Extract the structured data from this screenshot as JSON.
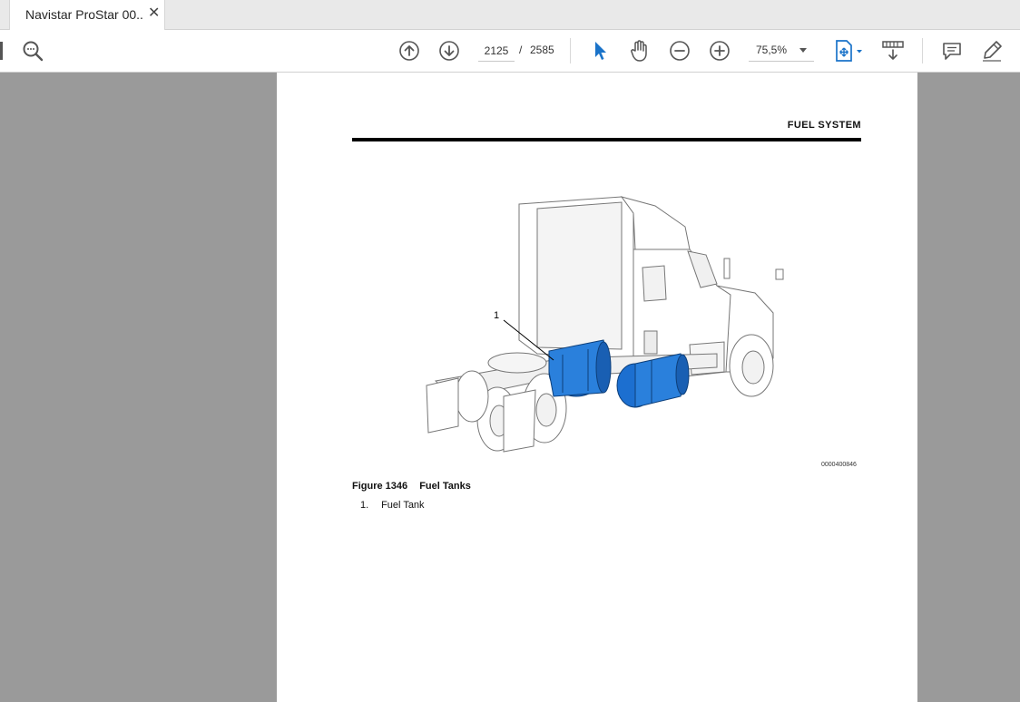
{
  "tab": {
    "title": "Navistar ProStar 00...",
    "close_glyph": "✕"
  },
  "toolbar": {
    "current_page": "2125",
    "page_separator": "/",
    "total_pages": "2585",
    "zoom": "75,5%",
    "icons": [
      "search-icon",
      "page-up-icon",
      "page-down-icon",
      "select-cursor-icon",
      "hand-tool-icon",
      "zoom-out-icon",
      "zoom-in-icon",
      "fit-page-icon",
      "scroll-mode-icon",
      "comment-icon",
      "highlight-pen-icon"
    ]
  },
  "document": {
    "section_title": "FUEL SYSTEM",
    "figure_id": "0000400846",
    "figure_callout": "1",
    "caption_number": "Figure 1346",
    "caption_title": "Fuel Tanks",
    "legend": [
      {
        "number": "1.",
        "label": "Fuel Tank"
      }
    ]
  },
  "colors": {
    "accent": "#1a73c9",
    "fuel_tank_blue": "#1c6fd0",
    "page_background": "#9a9a9a"
  }
}
